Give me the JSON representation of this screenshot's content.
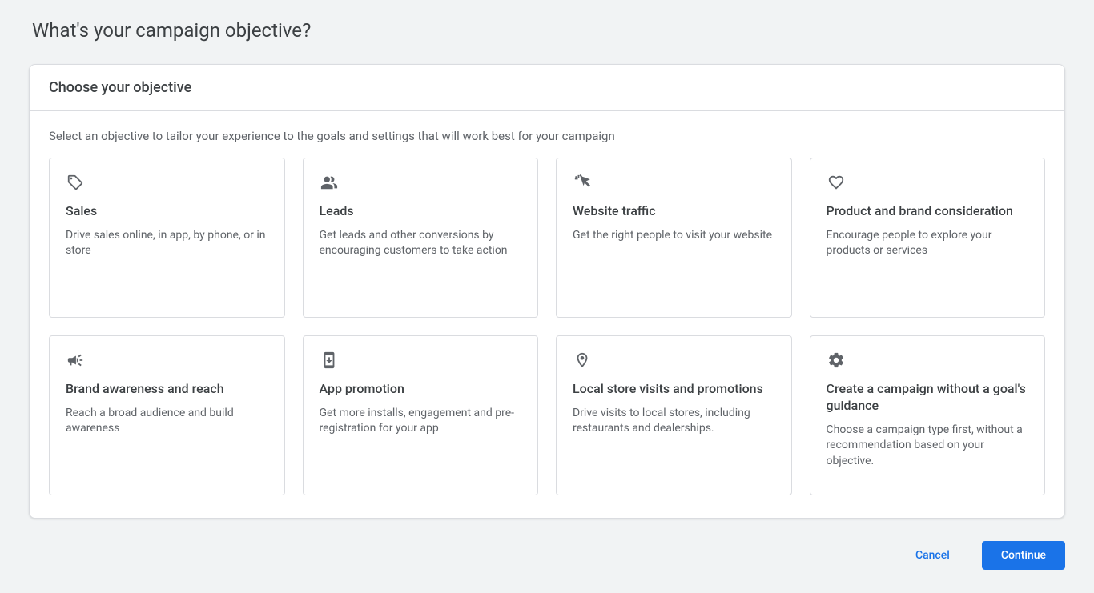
{
  "page": {
    "title": "What's your campaign objective?"
  },
  "card": {
    "header": "Choose your objective",
    "intro": "Select an objective to tailor your experience to the goals and settings that will work best for your campaign"
  },
  "objectives": [
    {
      "icon": "tag-icon",
      "title": "Sales",
      "desc": "Drive sales online, in app, by phone, or in store"
    },
    {
      "icon": "people-icon",
      "title": "Leads",
      "desc": "Get leads and other conversions by encouraging customers to take action"
    },
    {
      "icon": "cursor-click-icon",
      "title": "Website traffic",
      "desc": "Get the right people to visit your website"
    },
    {
      "icon": "heart-icon",
      "title": "Product and brand consideration",
      "desc": "Encourage people to explore your products or services"
    },
    {
      "icon": "megaphone-icon",
      "title": "Brand awareness and reach",
      "desc": "Reach a broad audience and build awareness"
    },
    {
      "icon": "phone-icon",
      "title": "App promotion",
      "desc": "Get more installs, engagement and pre-registration for your app"
    },
    {
      "icon": "location-pin-icon",
      "title": "Local store visits and promotions",
      "desc": "Drive visits to local stores, including restaurants and dealerships."
    },
    {
      "icon": "gear-icon",
      "title": "Create a campaign without a goal's guidance",
      "desc": "Choose a campaign type first, without a recommendation based on your objective."
    }
  ],
  "buttons": {
    "cancel": "Cancel",
    "continue": "Continue"
  }
}
